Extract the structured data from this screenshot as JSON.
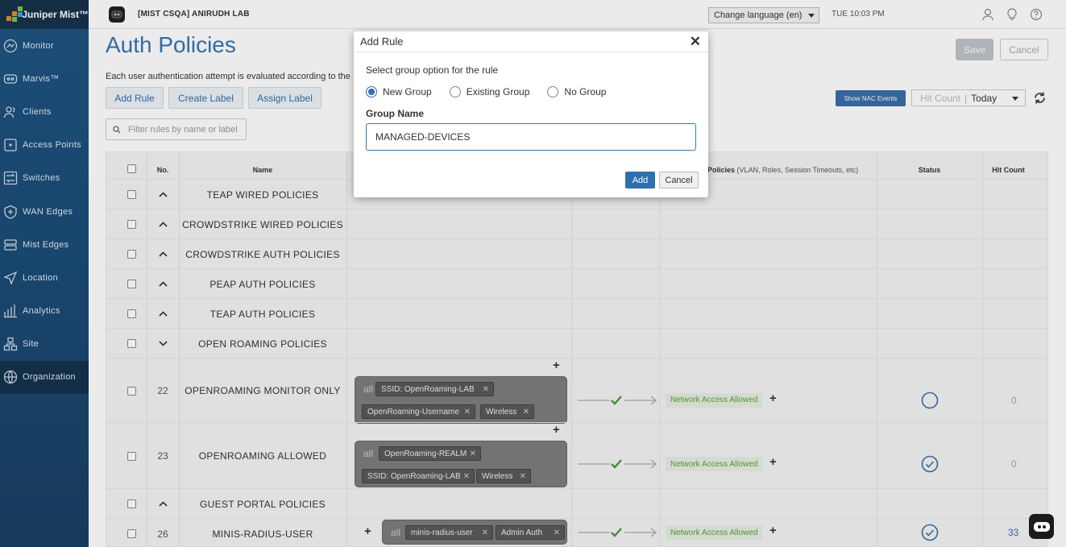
{
  "brand": {
    "name": "Juniper Mist™"
  },
  "sidebar": {
    "items": [
      {
        "label": "Monitor",
        "icon": "monitor-icon"
      },
      {
        "label": "Marvis™",
        "icon": "marvis-icon"
      },
      {
        "label": "Clients",
        "icon": "clients-icon"
      },
      {
        "label": "Access Points",
        "icon": "access-point-icon"
      },
      {
        "label": "Switches",
        "icon": "switch-icon"
      },
      {
        "label": "WAN Edges",
        "icon": "wan-edge-icon"
      },
      {
        "label": "Mist Edges",
        "icon": "mist-edge-icon"
      },
      {
        "label": "Location",
        "icon": "location-icon"
      },
      {
        "label": "Analytics",
        "icon": "analytics-icon"
      },
      {
        "label": "Site",
        "icon": "site-icon"
      },
      {
        "label": "Organization",
        "icon": "organization-icon",
        "active": true
      }
    ]
  },
  "topbar": {
    "org": "[MIST CSQA] ANIRUDH LAB",
    "language": "Change language (en)",
    "clock": "TUE 10:03 PM"
  },
  "page": {
    "title": "Auth Policies",
    "description": "Each user authentication attempt is evaluated according to the",
    "buttons": {
      "add_rule": "Add Rule",
      "create_label": "Create Label",
      "assign_label": "Assign Label",
      "save": "Save",
      "cancel": "Cancel",
      "show_nac": "Show NAC Events"
    },
    "search_placeholder": "Filter rules by name or label",
    "hit_count": {
      "label": "Hit Count",
      "value": "Today"
    }
  },
  "table": {
    "headers": {
      "no": "No.",
      "name": "Name",
      "policies": "Policies",
      "policies_note": "(VLAN, Roles, Session Timeouts, etc)",
      "status": "Status",
      "hit_count": "Hit Count"
    },
    "groups": [
      {
        "name": "TEAP WIRED POLICIES",
        "expanded": false
      },
      {
        "name": "CROWDSTRIKE WIRED POLICIES",
        "expanded": false
      },
      {
        "name": "CROWDSTRIKE AUTH POLICIES",
        "expanded": false
      },
      {
        "name": "PEAP AUTH POLICIES",
        "expanded": false
      },
      {
        "name": "TEAP AUTH POLICIES",
        "expanded": false
      },
      {
        "name": "OPEN ROAMING POLICIES",
        "expanded": true
      },
      {
        "name": "GUEST PORTAL POLICIES",
        "expanded": false
      }
    ],
    "rules": [
      {
        "no": "22",
        "name": "OPENROAMING MONITOR ONLY",
        "match": "all",
        "tags": [
          "SSID: OpenRoaming-LAB",
          "OpenRoaming-Username",
          "Wireless"
        ],
        "policy": "Network Access Allowed",
        "status": "disabled",
        "hits": "0"
      },
      {
        "no": "23",
        "name": "OPENROAMING ALLOWED",
        "match": "all",
        "tags": [
          "OpenRoaming-REALM",
          "SSID: OpenRoaming-LAB",
          "Wireless"
        ],
        "policy": "Network Access Allowed",
        "status": "enabled",
        "hits": "0"
      },
      {
        "no": "26",
        "name": "MINIS-RADIUS-USER",
        "match": "all",
        "tags": [
          "minis-radius-user",
          "Admin Auth"
        ],
        "policy": "Network Access Allowed",
        "status": "enabled",
        "hits": "33"
      }
    ]
  },
  "modal": {
    "title": "Add Rule",
    "question": "Select group option for the rule",
    "options": [
      "New Group",
      "Existing Group",
      "No Group"
    ],
    "selected": "New Group",
    "group_name_label": "Group Name",
    "group_name_value": "MANAGED-DEVICES",
    "add_label": "Add",
    "cancel_label": "Cancel"
  },
  "colors": {
    "accent": "#2f6fb0",
    "sidebar": "#1f5583",
    "success": "#5aa041"
  }
}
